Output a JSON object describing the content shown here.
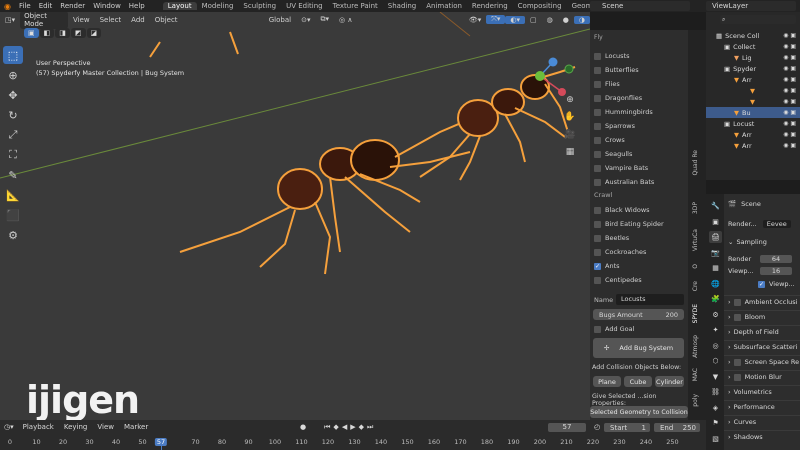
{
  "topbar": {
    "menus": [
      "File",
      "Edit",
      "Render",
      "Window",
      "Help"
    ],
    "workspaces": [
      "Layout",
      "Modeling",
      "Sculpting",
      "UV Editing",
      "Texture Paint",
      "Shading",
      "Animation",
      "Rendering",
      "Compositing",
      "Geometry Nodes"
    ],
    "active_workspace": "Layout",
    "scene": "Scene",
    "view_layer": "ViewLayer"
  },
  "viewport": {
    "mode": "Object Mode",
    "menus": [
      "View",
      "Select",
      "Add",
      "Object"
    ],
    "orientation": "Global",
    "info_line1": "User Perspective",
    "info_line2": "(57) Spyderfy Master Collection | Bug System",
    "logo": "ijigen"
  },
  "npanel": {
    "flying_bugs": [
      "Locusts",
      "Butterflies",
      "Flies",
      "Dragonflies",
      "Hummingbirds",
      "Sparrows",
      "Crows",
      "Seagulls",
      "Vampire Bats",
      "Australian Bats"
    ],
    "crawl_label": "Crawl",
    "crawl_bugs": [
      "Black Widows",
      "Bird Eating Spider",
      "Beetles",
      "Cockroaches",
      "Ants",
      "Centipedes"
    ],
    "checked_bug": "Ants",
    "name_label": "Name",
    "name_value": "Locusts",
    "bugs_amount_label": "Bugs Amount",
    "bugs_amount_value": "200",
    "add_goal": "Add Goal",
    "add_bug_system": "Add Bug System",
    "collision_label": "Add Collision Objects Below:",
    "collision_buttons": [
      "Plane",
      "Cube",
      "Cylinder"
    ],
    "give_selected": "Give Selected ...sion Properties:",
    "selected_geometry": "Selected Geometry to Collision"
  },
  "vtabs": [
    "Quad Re",
    "3DP",
    "VirtuCa",
    "O",
    "Cre",
    "SPYDE",
    "Atmosp",
    "MAC",
    "poly"
  ],
  "outliner": {
    "rows": [
      "Scene Coll",
      "Collect",
      "Lig",
      "Spyder",
      "Arr",
      "",
      "",
      "Bu",
      "Locust",
      "Arr",
      "Arr"
    ]
  },
  "properties": {
    "scene": "Scene",
    "render_engine_label": "Render...",
    "render_engine": "Eevee",
    "sampling": "Sampling",
    "render_label": "Render",
    "render_value": "64",
    "viewport_label": "Viewp...",
    "viewport_value": "16",
    "viewport_denoise": "Viewp...",
    "panels": [
      "Ambient Occlusi",
      "Bloom",
      "Depth of Field",
      "Subsurface Scatteri",
      "Screen Space Re",
      "Motion Blur",
      "Volumetrics",
      "Performance",
      "Curves",
      "Shadows"
    ]
  },
  "timeline": {
    "menus": [
      "Playback",
      "Keying",
      "View",
      "Marker"
    ],
    "current_frame": "57",
    "start_label": "Start",
    "start_value": "1",
    "end_label": "End",
    "end_value": "250",
    "ticks": [
      "0",
      "10",
      "20",
      "30",
      "40",
      "50",
      "57",
      "70",
      "80",
      "90",
      "100",
      "110",
      "120",
      "130",
      "140",
      "150",
      "160",
      "170",
      "180",
      "190",
      "200",
      "210",
      "220",
      "230",
      "240",
      "250"
    ]
  },
  "colors": {
    "accent": "#4b7cc4",
    "ant_outline": "#f5a03c",
    "viewport_bg": "#3a3a3a"
  }
}
